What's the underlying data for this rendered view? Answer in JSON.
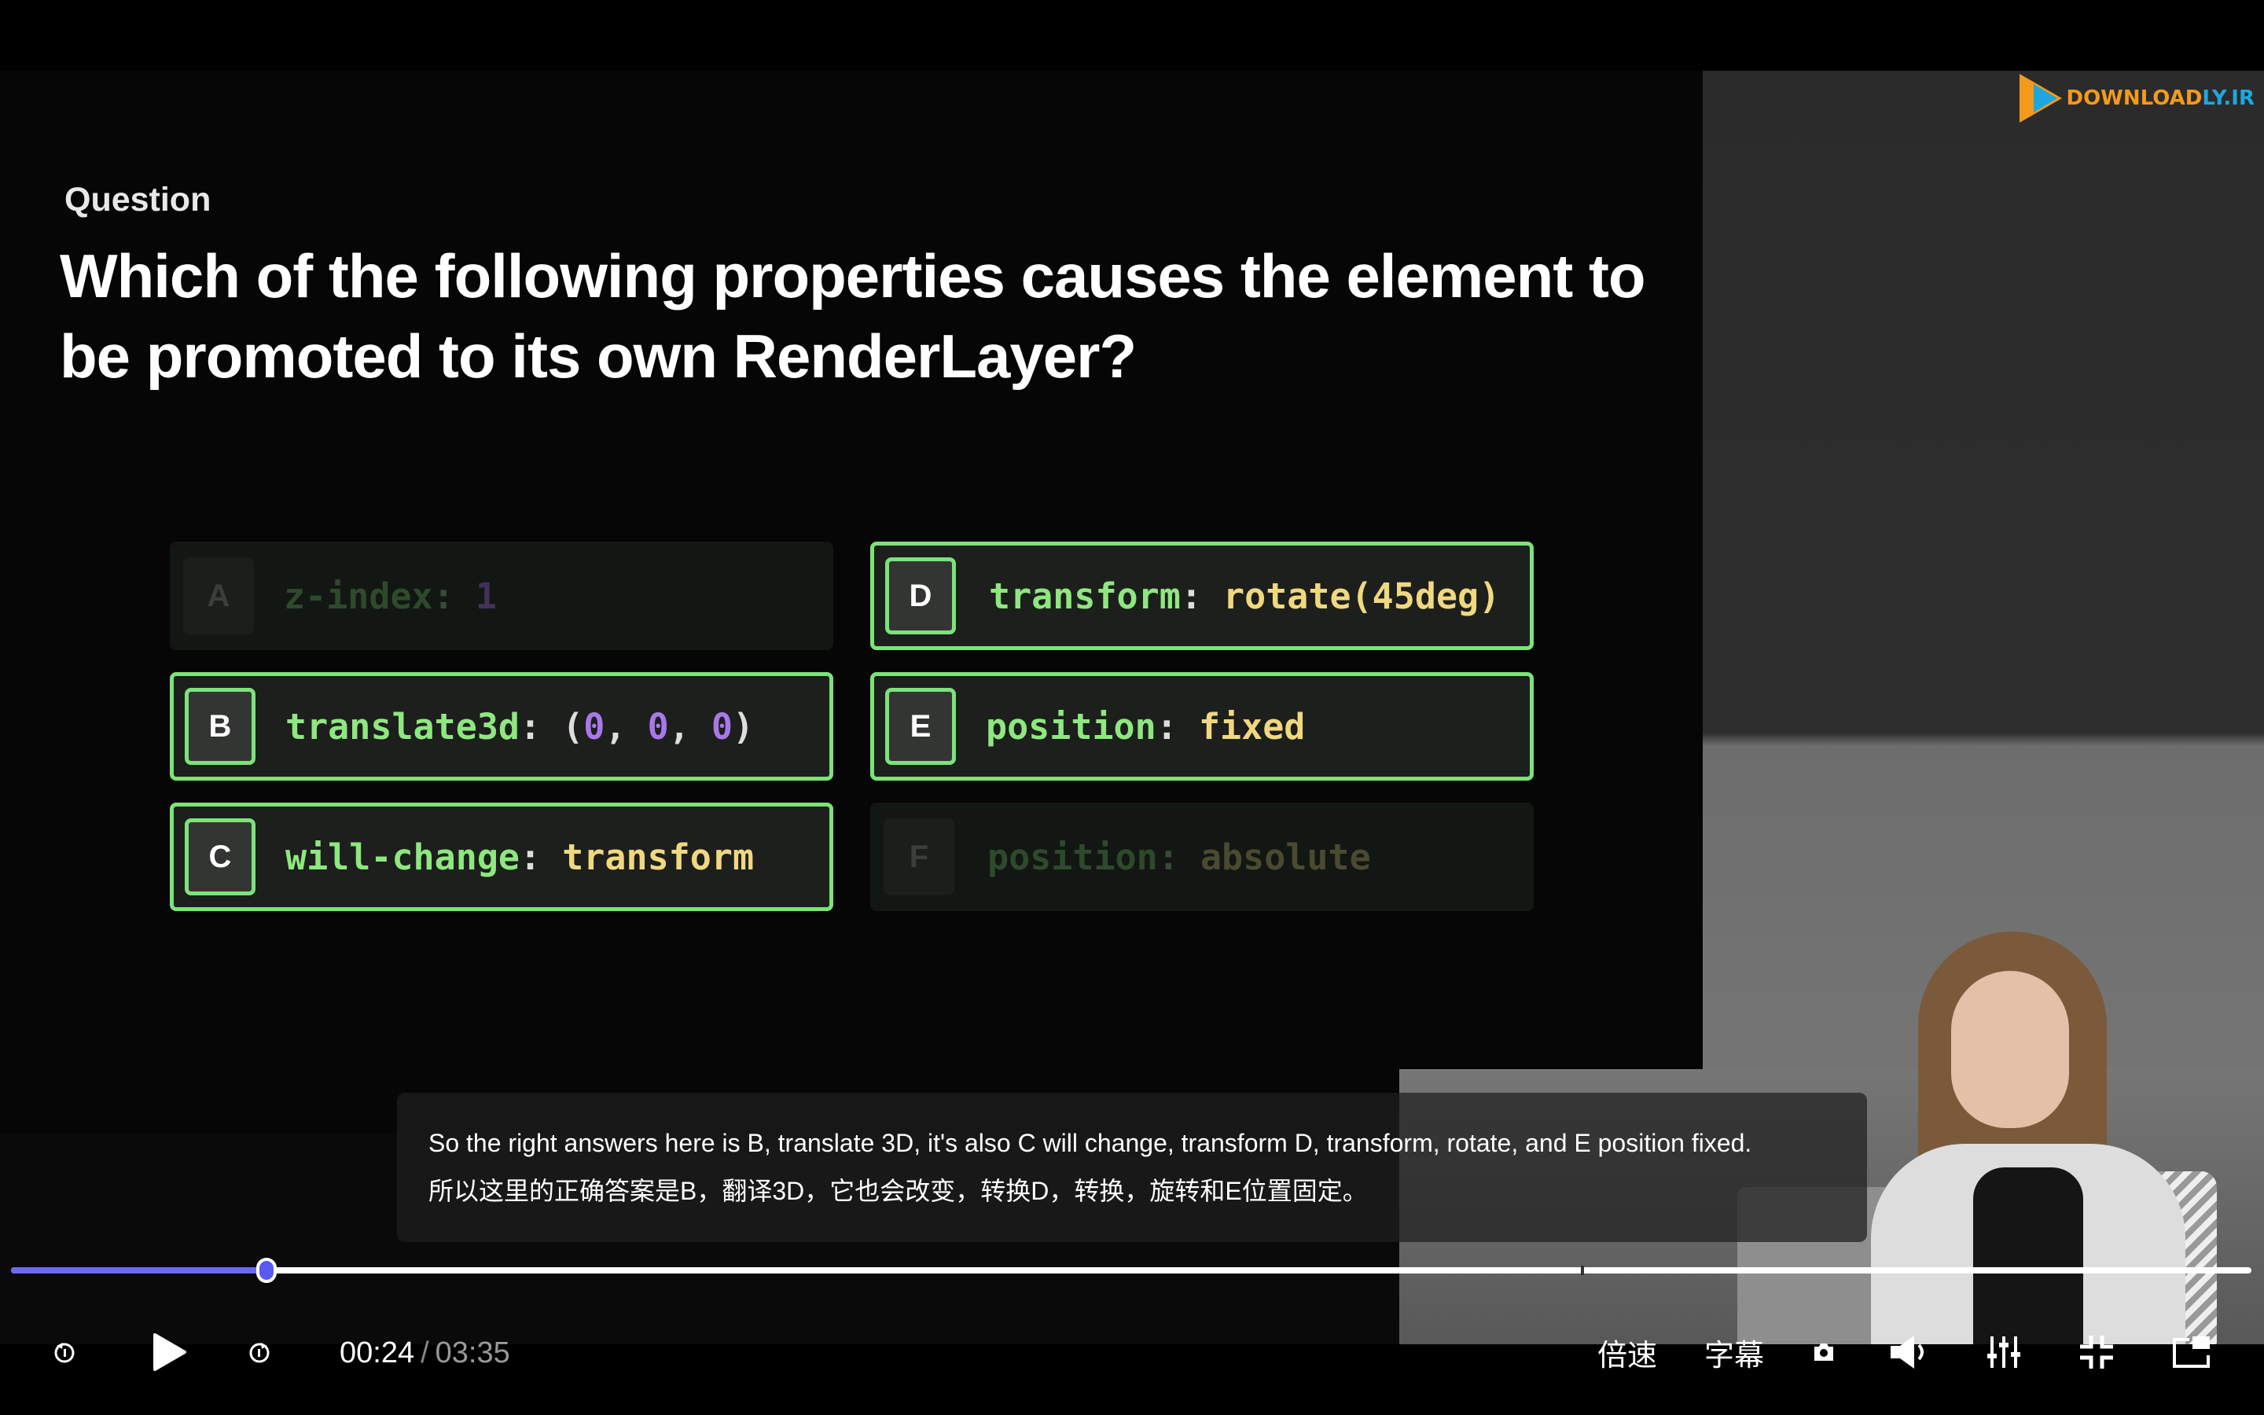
{
  "brand": {
    "logo_text_a": "DOWNLOAD",
    "logo_text_b": "LY.IR"
  },
  "slide": {
    "question_label": "Question",
    "question_text": "Which of the following properties causes the element to be promoted to its own RenderLayer?",
    "options": [
      {
        "letter": "A",
        "prop": "z-index",
        "punc": ": ",
        "val": "1",
        "selected": false
      },
      {
        "letter": "B",
        "prop": "translate3d",
        "punc": ": (",
        "n1": "0",
        "c1": ", ",
        "n2": "0",
        "c2": ", ",
        "n3": "0",
        "end": ")",
        "selected": true
      },
      {
        "letter": "C",
        "prop": "will-change",
        "punc": ": ",
        "val": "transform",
        "selected": true
      },
      {
        "letter": "D",
        "prop": "transform",
        "punc": ": ",
        "val": "rotate(45deg)",
        "selected": true
      },
      {
        "letter": "E",
        "prop": "position",
        "punc": ": ",
        "val": "fixed",
        "selected": true
      },
      {
        "letter": "F",
        "prop": "position",
        "punc": ": ",
        "val": "absolute",
        "selected": false
      }
    ],
    "colors": {
      "selected_border": "#7ce37a",
      "progress": "#6a6af0"
    }
  },
  "subtitles": {
    "english": "So the right answers here is B, translate 3D, it's also C will change, transform D, transform, rotate, and E position fixed.",
    "chinese": "所以这里的正确答案是B，翻译3D，它也会改变，转换D，转换，旋转和E位置固定。"
  },
  "player": {
    "current_time": "00:24",
    "separator": "/",
    "total_time": "03:35",
    "progress_fraction": 0.114,
    "speed_label": "倍速",
    "subtitle_label": "字幕",
    "icons": [
      "rewind-icon",
      "play-icon",
      "forward-icon",
      "screenshot-icon",
      "volume-icon",
      "settings-icon",
      "exit-fullscreen-icon",
      "pip-icon"
    ]
  }
}
